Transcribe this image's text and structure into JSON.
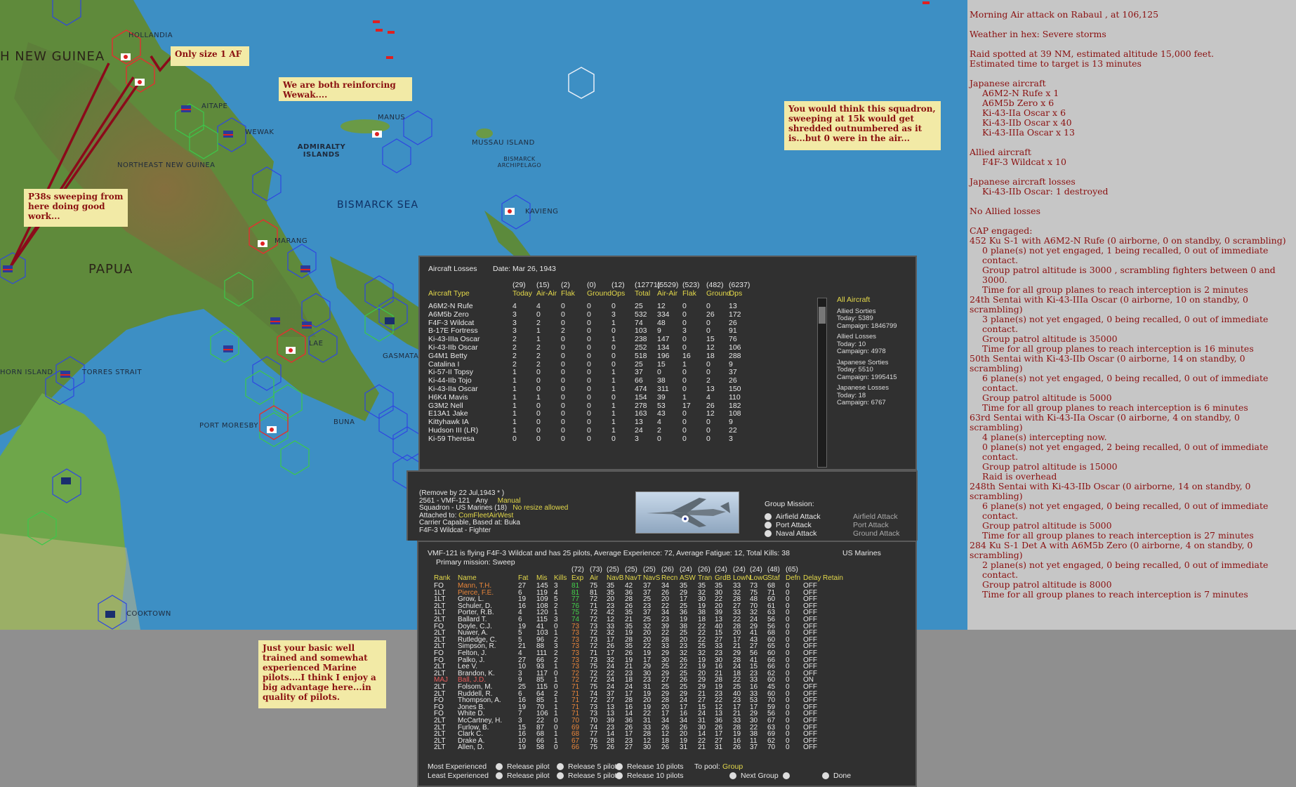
{
  "map": {
    "labels": [
      {
        "text": "H NEW GUINEA",
        "cls": "big"
      },
      {
        "text": "HOLLANDIA",
        "cls": ""
      },
      {
        "text": "AITAPE",
        "cls": ""
      },
      {
        "text": "WEWAK",
        "cls": ""
      },
      {
        "text": "MANUS",
        "cls": ""
      },
      {
        "text": "MUSSAU ISLAND",
        "cls": ""
      },
      {
        "text": "ADMIRALTY ISLANDS",
        "cls": ""
      },
      {
        "text": "NORTHEAST NEW GUINEA",
        "cls": ""
      },
      {
        "text": "BISMARCK ARCHIPELAGO",
        "cls": ""
      },
      {
        "text": "BISMARCK SEA",
        "cls": "sea"
      },
      {
        "text": "KAVIENG",
        "cls": ""
      },
      {
        "text": "MARANG",
        "cls": ""
      },
      {
        "text": "PAPUA",
        "cls": "big"
      },
      {
        "text": "LAE",
        "cls": ""
      },
      {
        "text": "GASMATA",
        "cls": ""
      },
      {
        "text": "HORN ISLAND",
        "cls": ""
      },
      {
        "text": "TORRES STRAIT",
        "cls": ""
      },
      {
        "text": "BUNA",
        "cls": ""
      },
      {
        "text": "PORT MORESBY",
        "cls": ""
      },
      {
        "text": "COOKTOWN",
        "cls": ""
      }
    ]
  },
  "notes": {
    "only_size": "Only size 1 AF",
    "reinforcing": "We are both reinforcing Wewak....",
    "p38": "P38s sweeping from here doing good work...",
    "squadron": "You would think this squadron, sweeping at 15k would get shredded outnumbered as it is...but 0 were in the air...",
    "marine": "Just your basic well trained and somewhat experienced Marine pilots....I think I enjoy a big advantage here...in quality of pilots."
  },
  "combat_log": [
    {
      "t": "Morning Air attack on Rabaul , at 106,125",
      "c": ""
    },
    {
      "t": "",
      "c": ""
    },
    {
      "t": "Weather in hex: Severe storms",
      "c": ""
    },
    {
      "t": "",
      "c": ""
    },
    {
      "t": "Raid spotted at 39 NM, estimated altitude 15,000 feet.",
      "c": ""
    },
    {
      "t": "Estimated time to target is 13 minutes",
      "c": ""
    },
    {
      "t": "",
      "c": ""
    },
    {
      "t": "Japanese aircraft",
      "c": ""
    },
    {
      "t": "A6M2-N Rufe x 1",
      "c": "ind"
    },
    {
      "t": "A6M5b Zero x 6",
      "c": "ind"
    },
    {
      "t": "Ki-43-IIa Oscar x 6",
      "c": "ind"
    },
    {
      "t": "Ki-43-IIb Oscar x 40",
      "c": "ind"
    },
    {
      "t": "Ki-43-IIIa Oscar x 13",
      "c": "ind"
    },
    {
      "t": "",
      "c": ""
    },
    {
      "t": "Allied aircraft",
      "c": ""
    },
    {
      "t": "F4F-3 Wildcat x 10",
      "c": "ind"
    },
    {
      "t": "",
      "c": ""
    },
    {
      "t": "Japanese aircraft losses",
      "c": ""
    },
    {
      "t": "Ki-43-IIb Oscar: 1 destroyed",
      "c": "ind"
    },
    {
      "t": "",
      "c": ""
    },
    {
      "t": "No Allied losses",
      "c": ""
    },
    {
      "t": "",
      "c": ""
    },
    {
      "t": "CAP engaged:",
      "c": ""
    },
    {
      "t": "452 Ku S-1 with A6M2-N Rufe (0 airborne, 0 on standby, 0 scrambling)",
      "c": ""
    },
    {
      "t": "0 plane(s) not yet engaged, 1 being recalled, 0 out of immediate contact.",
      "c": "ind"
    },
    {
      "t": "Group patrol altitude is 3000 , scrambling fighters between 0 and 3000.",
      "c": "ind"
    },
    {
      "t": "Time for all group planes to reach interception is 2 minutes",
      "c": "ind"
    },
    {
      "t": "24th Sentai with Ki-43-IIIa Oscar (0 airborne, 10 on standby, 0 scrambling)",
      "c": ""
    },
    {
      "t": "3 plane(s) not yet engaged, 0 being recalled, 0 out of immediate contact.",
      "c": "ind"
    },
    {
      "t": "Group patrol altitude is 35000",
      "c": "ind"
    },
    {
      "t": "Time for all group planes to reach interception is 16 minutes",
      "c": "ind"
    },
    {
      "t": "50th Sentai with Ki-43-IIb Oscar (0 airborne, 14 on standby, 0 scrambling)",
      "c": ""
    },
    {
      "t": "6 plane(s) not yet engaged, 0 being recalled, 0 out of immediate contact.",
      "c": "ind"
    },
    {
      "t": "Group patrol altitude is 5000",
      "c": "ind"
    },
    {
      "t": "Time for all group planes to reach interception is 6 minutes",
      "c": "ind"
    },
    {
      "t": "63rd Sentai with Ki-43-IIa Oscar (0 airborne, 4 on standby, 0 scrambling)",
      "c": ""
    },
    {
      "t": "4 plane(s) intercepting now.",
      "c": "ind"
    },
    {
      "t": "0 plane(s) not yet engaged, 2 being recalled, 0 out of immediate contact.",
      "c": "ind"
    },
    {
      "t": "Group patrol altitude is 15000",
      "c": "ind"
    },
    {
      "t": "Raid is overhead",
      "c": "ind"
    },
    {
      "t": "248th Sentai with Ki-43-IIb Oscar (0 airborne, 14 on standby, 0 scrambling)",
      "c": ""
    },
    {
      "t": "6 plane(s) not yet engaged, 0 being recalled, 0 out of immediate contact.",
      "c": "ind"
    },
    {
      "t": "Group patrol altitude is 5000",
      "c": "ind"
    },
    {
      "t": "Time for all group planes to reach interception is 27 minutes",
      "c": "ind"
    },
    {
      "t": "284 Ku S-1 Det A with A6M5b Zero (0 airborne, 4 on standby, 0 scrambling)",
      "c": ""
    },
    {
      "t": "2 plane(s) not yet engaged, 0 being recalled, 0 out of immediate contact.",
      "c": "ind"
    },
    {
      "t": "Group patrol altitude is 8000",
      "c": "ind"
    },
    {
      "t": "Time for all group planes to reach interception is 7 minutes",
      "c": "ind"
    }
  ],
  "losses": {
    "title": "Aircraft Losses",
    "date": "Date: Mar 26, 1943",
    "totals": [
      "(29)",
      "(15)",
      "(2)",
      "(0)",
      "(12)",
      "(12771)",
      "(5529)",
      "(523)",
      "(482)",
      "(6237)"
    ],
    "headers": [
      "Aircraft Type",
      "Today",
      "Air-Air",
      "Flak",
      "Ground",
      "Ops",
      "Total",
      "Air-Air",
      "Flak",
      "Ground",
      "Ops"
    ],
    "rows": [
      [
        "A6M2-N Rufe",
        "4",
        "4",
        "0",
        "0",
        "0",
        "25",
        "12",
        "0",
        "0",
        "13"
      ],
      [
        "A6M5b Zero",
        "3",
        "0",
        "0",
        "0",
        "3",
        "532",
        "334",
        "0",
        "26",
        "172"
      ],
      [
        "F4F-3 Wildcat",
        "3",
        "2",
        "0",
        "0",
        "1",
        "74",
        "48",
        "0",
        "0",
        "26"
      ],
      [
        "B-17E Fortress",
        "3",
        "1",
        "2",
        "0",
        "0",
        "103",
        "9",
        "3",
        "0",
        "91"
      ],
      [
        "Ki-43-IIIa Oscar",
        "2",
        "1",
        "0",
        "0",
        "1",
        "238",
        "147",
        "0",
        "15",
        "76"
      ],
      [
        "Ki-43-IIb Oscar",
        "2",
        "2",
        "0",
        "0",
        "0",
        "252",
        "134",
        "0",
        "12",
        "106"
      ],
      [
        "G4M1 Betty",
        "2",
        "2",
        "0",
        "0",
        "0",
        "518",
        "196",
        "16",
        "18",
        "288"
      ],
      [
        "Catalina I",
        "2",
        "2",
        "0",
        "0",
        "0",
        "25",
        "15",
        "1",
        "0",
        "9"
      ],
      [
        "Ki-57-II Topsy",
        "1",
        "0",
        "0",
        "0",
        "1",
        "37",
        "0",
        "0",
        "0",
        "37"
      ],
      [
        "Ki-44-IIb Tojo",
        "1",
        "0",
        "0",
        "0",
        "1",
        "66",
        "38",
        "0",
        "2",
        "26"
      ],
      [
        "Ki-43-IIa Oscar",
        "1",
        "0",
        "0",
        "0",
        "1",
        "474",
        "311",
        "0",
        "13",
        "150"
      ],
      [
        "H6K4 Mavis",
        "1",
        "1",
        "0",
        "0",
        "0",
        "154",
        "39",
        "1",
        "4",
        "110"
      ],
      [
        "G3M2 Nell",
        "1",
        "0",
        "0",
        "0",
        "1",
        "278",
        "53",
        "17",
        "26",
        "182"
      ],
      [
        "E13A1 Jake",
        "1",
        "0",
        "0",
        "0",
        "1",
        "163",
        "43",
        "0",
        "12",
        "108"
      ],
      [
        "Kittyhawk IA",
        "1",
        "0",
        "0",
        "0",
        "1",
        "13",
        "4",
        "0",
        "0",
        "9"
      ],
      [
        "Hudson III (LR)",
        "1",
        "0",
        "0",
        "0",
        "1",
        "24",
        "2",
        "0",
        "0",
        "22"
      ],
      [
        "Ki-59 Theresa",
        "0",
        "0",
        "0",
        "0",
        "0",
        "3",
        "0",
        "0",
        "0",
        "3"
      ]
    ],
    "side": {
      "title": "All Aircraft",
      "allied_sorties": "Allied Sorties",
      "allied_sorties_today": "Today:   5389",
      "allied_sorties_campaign": "Campaign: 1846799",
      "allied_losses": "Allied Losses",
      "allied_losses_today": "Today:   10",
      "allied_losses_campaign": "Campaign: 4978",
      "jap_sorties": "Japanese Sorties",
      "jap_sorties_today": "Today:   5510",
      "jap_sorties_campaign": "Campaign: 1995415",
      "jap_losses": "Japanese Losses",
      "jap_losses_today": "Today:   18",
      "jap_losses_campaign": "Campaign: 6767"
    }
  },
  "unit": {
    "remove": "(Remove by 22 Jul,1943 * )",
    "id": "2561 - VMF-121",
    "any": "Any",
    "manual": "Manual",
    "squadron": "Squadron - US Marines (18)",
    "resize": "No resize allowed",
    "attached_label": "Attached to:",
    "attached": "ComFleetAirWest",
    "carrier": "Carrier Capable, Based at: Buka",
    "aircraft": "F4F-3 Wildcat - Fighter",
    "group_mission": "Group Mission:",
    "missions_left": [
      "Airfield Attack",
      "Port Attack",
      "Naval Attack"
    ],
    "missions_right": [
      "Airfield Attack",
      "Port Attack",
      "Ground Attack"
    ]
  },
  "pilots": {
    "summary": "VMF-121 is flying F4F-3 Wildcat and has 25 pilots,  Average Experience: 72,  Average Fatigue: 12,  Total Kills: 38",
    "service": "US Marines",
    "primary": "Primary mission: Sweep",
    "avgs": [
      "(72)",
      "(73)",
      "(25)",
      "(25)",
      "(25)",
      "(26)",
      "(24)",
      "(26)",
      "(24)",
      "(24)",
      "(24)",
      "(48)",
      "(65)"
    ],
    "headers": [
      "Rank",
      "Name",
      "Fat",
      "Mis",
      "Kills",
      "Exp",
      "Air",
      "NavB",
      "NavT",
      "NavS",
      "Recn",
      "ASW",
      "Tran",
      "GrdB",
      "LowN",
      "LowG",
      "Staf",
      "Defn",
      "Delay",
      "Retain"
    ],
    "rows": [
      [
        "FO",
        "Mann, T.H.",
        "27",
        "145",
        "3",
        "81",
        "75",
        "35",
        "42",
        "37",
        "34",
        "35",
        "35",
        "35",
        "33",
        "73",
        "68",
        "0",
        "OFF"
      ],
      [
        "1LT",
        "Pierce, F.E.",
        "6",
        "119",
        "4",
        "81",
        "81",
        "35",
        "36",
        "37",
        "26",
        "29",
        "32",
        "30",
        "32",
        "75",
        "71",
        "0",
        "OFF"
      ],
      [
        "1LT",
        "Grow, L.",
        "19",
        "109",
        "5",
        "77",
        "72",
        "20",
        "28",
        "25",
        "20",
        "17",
        "30",
        "22",
        "28",
        "48",
        "60",
        "0",
        "OFF"
      ],
      [
        "2LT",
        "Schuler, D.",
        "16",
        "108",
        "2",
        "76",
        "71",
        "23",
        "26",
        "23",
        "22",
        "25",
        "19",
        "20",
        "27",
        "70",
        "61",
        "0",
        "OFF"
      ],
      [
        "1LT",
        "Porter, R.B.",
        "4",
        "120",
        "1",
        "75",
        "72",
        "42",
        "35",
        "37",
        "34",
        "36",
        "38",
        "39",
        "33",
        "32",
        "63",
        "0",
        "OFF"
      ],
      [
        "2LT",
        "Ballard T.",
        "6",
        "115",
        "3",
        "74",
        "72",
        "12",
        "21",
        "25",
        "23",
        "19",
        "18",
        "13",
        "22",
        "24",
        "56",
        "0",
        "OFF"
      ],
      [
        "FO",
        "Doyle, C.J.",
        "19",
        "41",
        "0",
        "73",
        "73",
        "33",
        "35",
        "32",
        "39",
        "38",
        "22",
        "40",
        "28",
        "29",
        "56",
        "0",
        "OFF"
      ],
      [
        "2LT",
        "Nuwer, A.",
        "5",
        "103",
        "1",
        "73",
        "72",
        "32",
        "19",
        "20",
        "22",
        "25",
        "22",
        "15",
        "20",
        "41",
        "68",
        "0",
        "OFF"
      ],
      [
        "2LT",
        "Rutledge, C.",
        "5",
        "96",
        "2",
        "73",
        "73",
        "17",
        "28",
        "20",
        "28",
        "20",
        "22",
        "27",
        "17",
        "43",
        "60",
        "0",
        "OFF"
      ],
      [
        "2LT",
        "Simpson, R.",
        "21",
        "88",
        "3",
        "73",
        "72",
        "26",
        "35",
        "22",
        "33",
        "23",
        "25",
        "33",
        "21",
        "27",
        "65",
        "0",
        "OFF"
      ],
      [
        "FO",
        "Felton, J.",
        "4",
        "111",
        "2",
        "73",
        "71",
        "17",
        "26",
        "19",
        "29",
        "32",
        "32",
        "23",
        "29",
        "56",
        "60",
        "0",
        "OFF"
      ],
      [
        "FO",
        "Palko, J.",
        "27",
        "66",
        "2",
        "73",
        "73",
        "32",
        "19",
        "17",
        "30",
        "26",
        "19",
        "30",
        "28",
        "41",
        "66",
        "0",
        "OFF"
      ],
      [
        "2LT",
        "Lee V.",
        "10",
        "93",
        "1",
        "73",
        "75",
        "24",
        "21",
        "29",
        "25",
        "22",
        "19",
        "16",
        "24",
        "15",
        "66",
        "0",
        "OFF"
      ],
      [
        "2LT",
        "Brandon, K.",
        "3",
        "117",
        "0",
        "72",
        "72",
        "22",
        "23",
        "30",
        "29",
        "25",
        "20",
        "21",
        "18",
        "23",
        "62",
        "0",
        "OFF"
      ],
      [
        "MAJ",
        "Ball, J.D.",
        "9",
        "85",
        "1",
        "72",
        "72",
        "24",
        "18",
        "23",
        "27",
        "26",
        "29",
        "28",
        "22",
        "33",
        "60",
        "0",
        "ON"
      ],
      [
        "2LT",
        "Folsom, M.",
        "25",
        "115",
        "0",
        "71",
        "75",
        "24",
        "24",
        "31",
        "25",
        "25",
        "29",
        "19",
        "25",
        "16",
        "45",
        "0",
        "OFF"
      ],
      [
        "2LT",
        "Ruddell, R.",
        "6",
        "64",
        "2",
        "71",
        "74",
        "37",
        "17",
        "19",
        "29",
        "29",
        "21",
        "23",
        "40",
        "33",
        "60",
        "0",
        "OFF"
      ],
      [
        "FO",
        "Thompson, A.",
        "16",
        "85",
        "1",
        "71",
        "72",
        "27",
        "28",
        "20",
        "28",
        "24",
        "27",
        "22",
        "23",
        "53",
        "70",
        "0",
        "OFF"
      ],
      [
        "FO",
        "Jones B.",
        "19",
        "70",
        "1",
        "71",
        "73",
        "13",
        "16",
        "19",
        "20",
        "17",
        "15",
        "12",
        "17",
        "17",
        "59",
        "0",
        "OFF"
      ],
      [
        "FO",
        "White D.",
        "7",
        "106",
        "1",
        "71",
        "73",
        "13",
        "14",
        "22",
        "17",
        "16",
        "24",
        "13",
        "21",
        "29",
        "56",
        "0",
        "OFF"
      ],
      [
        "2LT",
        "McCartney, H.",
        "3",
        "22",
        "0",
        "70",
        "70",
        "39",
        "36",
        "31",
        "34",
        "34",
        "31",
        "36",
        "33",
        "30",
        "67",
        "0",
        "OFF"
      ],
      [
        "2LT",
        "Furlow, B.",
        "15",
        "87",
        "0",
        "69",
        "74",
        "23",
        "26",
        "33",
        "26",
        "26",
        "30",
        "26",
        "28",
        "22",
        "63",
        "0",
        "OFF"
      ],
      [
        "2LT",
        "Clark C.",
        "16",
        "68",
        "1",
        "68",
        "77",
        "14",
        "17",
        "28",
        "12",
        "20",
        "14",
        "17",
        "19",
        "38",
        "69",
        "0",
        "OFF"
      ],
      [
        "2LT",
        "Drake A.",
        "10",
        "66",
        "1",
        "67",
        "76",
        "28",
        "23",
        "12",
        "18",
        "19",
        "22",
        "27",
        "16",
        "11",
        "62",
        "0",
        "OFF"
      ],
      [
        "2LT",
        "Allen, D.",
        "19",
        "58",
        "0",
        "66",
        "75",
        "26",
        "27",
        "30",
        "26",
        "31",
        "21",
        "31",
        "26",
        "37",
        "70",
        "0",
        "OFF"
      ]
    ],
    "footer": {
      "most": "Most Experienced",
      "least": "Least Experienced",
      "rel1": "Release pilot",
      "rel5": "Release 5 pilots",
      "rel10": "Release 10 pilots",
      "topool": "To pool:",
      "group": "Group",
      "next": "Next Group",
      "done": "Done"
    }
  }
}
